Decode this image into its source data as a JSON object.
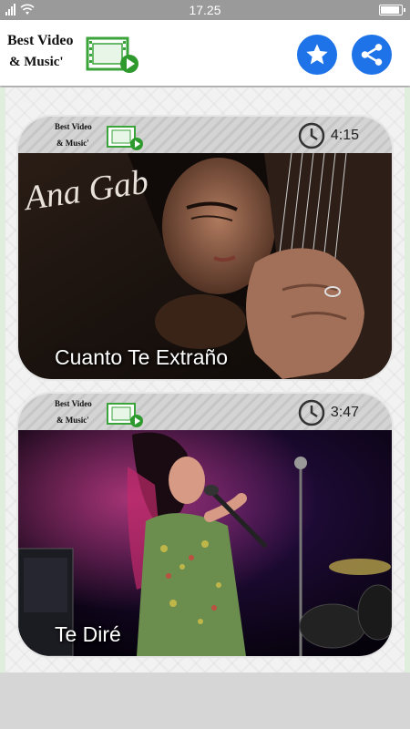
{
  "status_bar": {
    "time": "17.25"
  },
  "app_bar": {
    "logo_line1": "Best Video",
    "logo_line2": "& Music'",
    "star_icon": "star-icon",
    "share_icon": "share-icon",
    "accent_color": "#1e73e8"
  },
  "videos": [
    {
      "logo_line1": "Best Video",
      "logo_line2": "& Music'",
      "duration": "4:15",
      "title": "Cuanto Te Extraño",
      "thumb_text": "Ana Gab"
    },
    {
      "logo_line1": "Best Video",
      "logo_line2": "& Music'",
      "duration": "3:47",
      "title": "Te Diré"
    }
  ]
}
